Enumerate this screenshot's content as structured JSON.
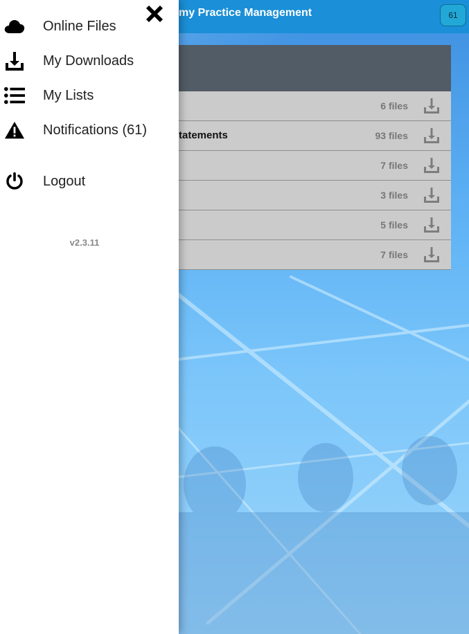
{
  "app": {
    "title": "my Practice Management",
    "notification_badge": "61"
  },
  "file_list": [
    {
      "title": "",
      "count": "6 files"
    },
    {
      "title": "tatements",
      "count": "93 files"
    },
    {
      "title": "",
      "count": "7 files"
    },
    {
      "title": "",
      "count": "3 files"
    },
    {
      "title": "",
      "count": "5 files"
    },
    {
      "title": "",
      "count": "7 files"
    }
  ],
  "drawer": {
    "items": [
      {
        "label": "Online Files",
        "icon": "cloud-icon"
      },
      {
        "label": "My Downloads",
        "icon": "download-icon"
      },
      {
        "label": "My Lists",
        "icon": "list-icon"
      },
      {
        "label": "Notifications (61)",
        "icon": "warning-icon"
      },
      {
        "label": "Logout",
        "icon": "power-icon"
      }
    ],
    "version": "v2.3.11"
  },
  "colors": {
    "topbar": "#1b8fd8",
    "panel_header": "#525c66",
    "row_bg": "#cbcbcb",
    "badge": "#22a8d6"
  }
}
